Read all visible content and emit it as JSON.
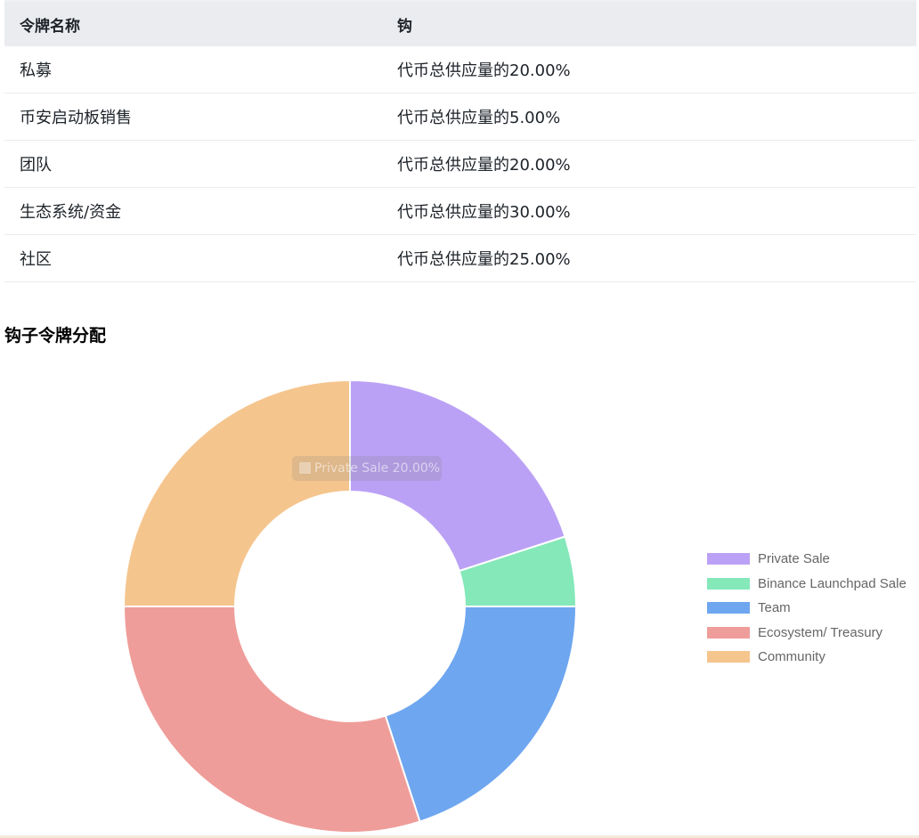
{
  "table": {
    "headers": [
      "令牌名称",
      "钩"
    ],
    "rows": [
      {
        "name": "私募",
        "share": "代币总供应量的20.00%"
      },
      {
        "name": "币安启动板销售",
        "share": "代币总供应量的5.00%"
      },
      {
        "name": "团队",
        "share": "代币总供应量的20.00%"
      },
      {
        "name": "生态系统/资金",
        "share": "代币总供应量的30.00%"
      },
      {
        "name": "社区",
        "share": "代币总供应量的25.00%"
      }
    ]
  },
  "section_title": "钩子令牌分配",
  "tooltip_text": "Private Sale 20.00%",
  "chart_data": {
    "type": "pie",
    "variant": "doughnut",
    "categories": [
      "Private Sale",
      "Binance Launchpad Sale",
      "Team",
      "Ecosystem/ Treasury",
      "Community"
    ],
    "values": [
      20,
      5,
      20,
      30,
      25
    ],
    "unit": "%",
    "colors": [
      "#bba1f5",
      "#84e8b9",
      "#6ea6f0",
      "#ef9d9a",
      "#f5c58e"
    ],
    "legend_position": "right"
  }
}
